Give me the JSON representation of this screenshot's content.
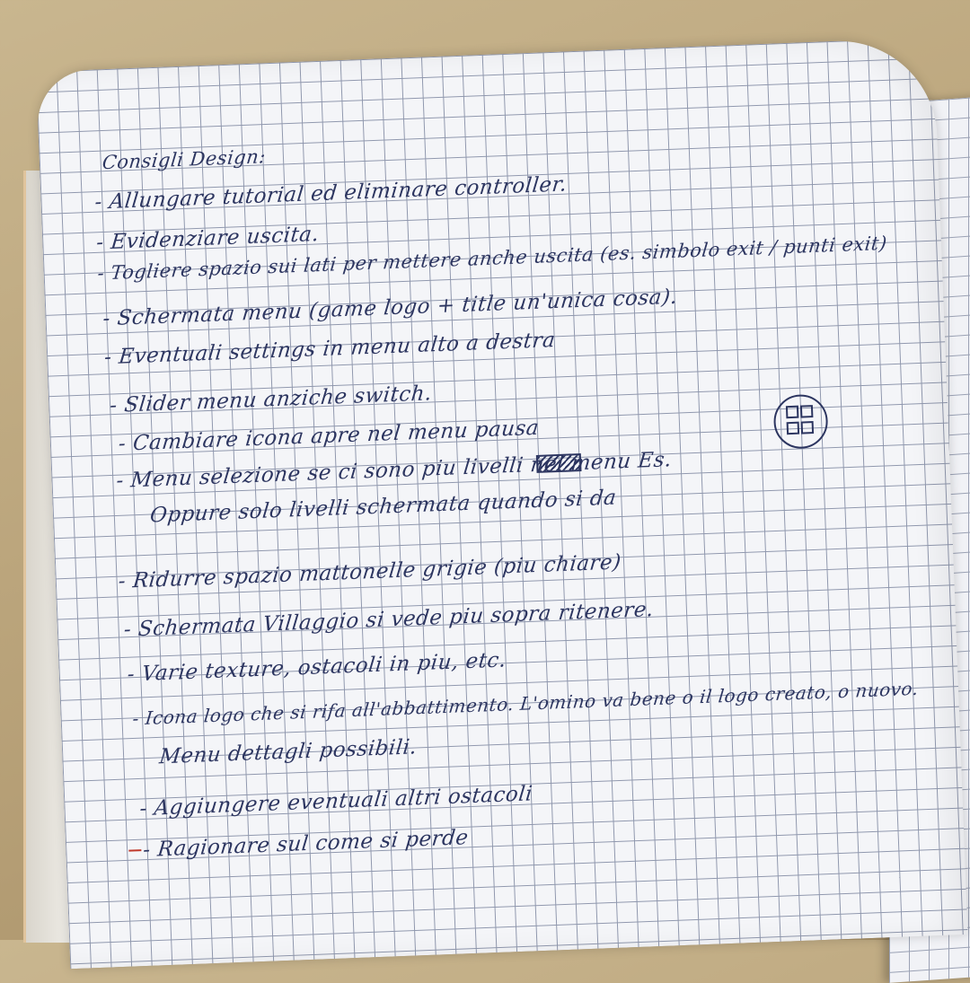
{
  "notebook": {
    "title": "Consigli Design:",
    "lines": [
      "- Allungare tutorial ed eliminare controller.",
      "- Evidenziare uscita.",
      "- Togliere spazio sui lati per mettere anche uscita (es. simbolo exit / punti exit)",
      "- Schermata menu (game logo + title un'unica cosa).",
      "- Eventuali settings in menu alto a destra",
      "- Slider menu anziche switch.",
      "- Cambiare icona apre nel menu pausa",
      "- Menu selezione se ci sono piu livelli nel menu Es.",
      "Oppure solo livelli schermata quando si da",
      "- Ridurre spazio mattonelle grigie (piu chiare)",
      "- Schermata Villaggio si vede piu sopra ritenere.",
      "- Varie texture, ostacoli in piu, etc.",
      "- Icona logo che si rifa all'abbattimento. L'omino va bene o il logo creato, o nuovo.",
      "Menu dettagli possibili.",
      "- Aggiungere eventuali altri ostacoli",
      "- Ragionare sul come si perde"
    ]
  }
}
